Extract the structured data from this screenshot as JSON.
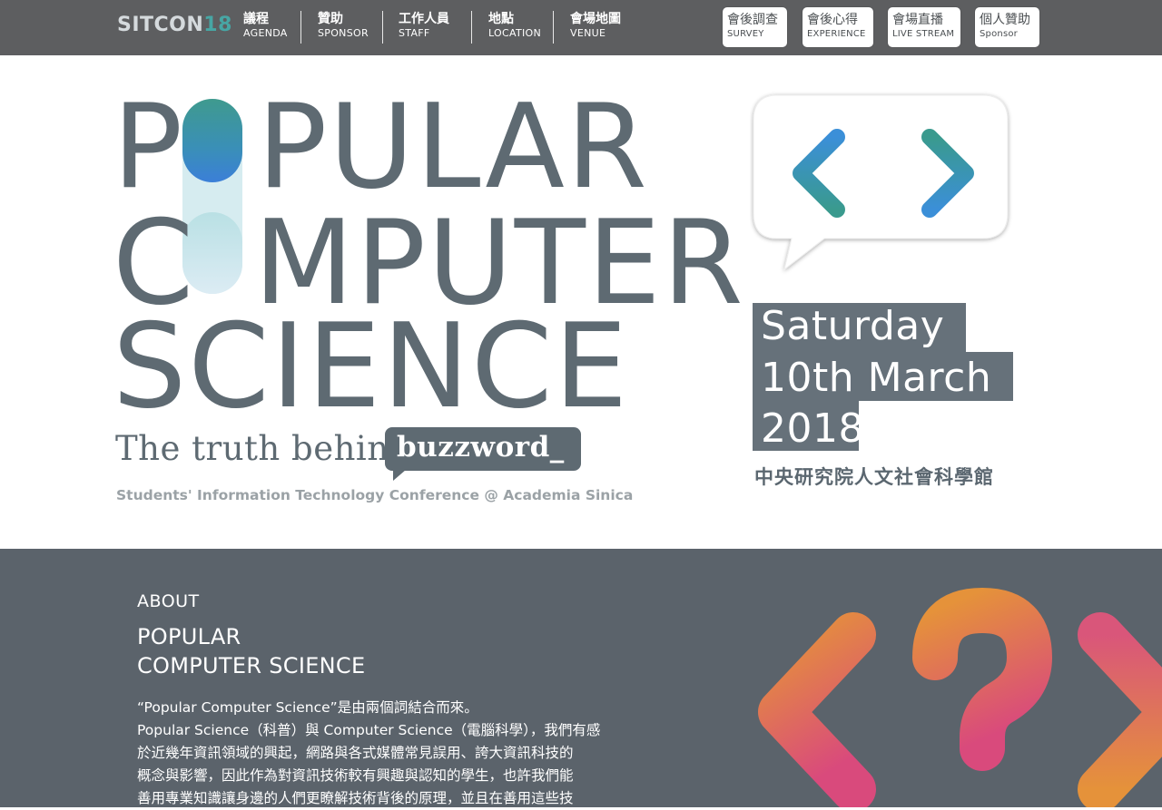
{
  "nav": {
    "brand_text": "SITCON",
    "brand_num": "18",
    "items": [
      {
        "zh": "議程",
        "en": "AGENDA"
      },
      {
        "zh": "贊助",
        "en": "SPONSOR"
      },
      {
        "zh": "工作人員",
        "en": "STAFF"
      },
      {
        "zh": "地點",
        "en": "LOCATION"
      },
      {
        "zh": "會場地圖",
        "en": "VENUE"
      }
    ],
    "buttons": [
      {
        "zh": "會後調查",
        "en": "SURVEY"
      },
      {
        "zh": "會後心得",
        "en": "EXPERIENCE"
      },
      {
        "zh": "會場直播",
        "en": "LIVE STREAM"
      },
      {
        "zh": "個人贊助",
        "en": "Sponsor"
      }
    ]
  },
  "hero": {
    "line1_a": "P",
    "line1_b": "PULAR",
    "line2_a": "C",
    "line2_b": "MPUTER",
    "line3": "SCIENCE",
    "tagline": "The truth behind",
    "buzzword": "buzzword_",
    "subline": "Students' Information Technology Conference @ Academia Sinica",
    "date_line1": "Saturday",
    "date_line2": "10th March",
    "date_line3": "2018",
    "venue": "中央研究院人文社會科學館"
  },
  "about": {
    "heading": "ABOUT",
    "title_line1": "POPULAR",
    "title_line2": "COMPUTER SCIENCE",
    "body": [
      "“Popular Computer Science”是由兩個詞結合而來。",
      "Popular Science（科普）與 Computer Science（電腦科學），我們有感",
      "於近幾年資訊領域的興起，網路與各式媒體常見誤用、誇大資訊科技的",
      "概念與影響，因此作為對資訊技術較有興趣與認知的學生，也許我們能",
      "善用專業知識讓身邊的人們更瞭解技術背後的原理，並且在善用這些技"
    ]
  },
  "colors": {
    "nav_bg": "#5d5e60",
    "brand_accent": "#47a6a4",
    "title_gray": "#5e6a72",
    "about_bg": "#5b636b",
    "arrow_blue": "#3b8fd8",
    "arrow_teal": "#3a9a8e",
    "deco_orange": "#e5923a",
    "deco_pink": "#d94a7c"
  }
}
